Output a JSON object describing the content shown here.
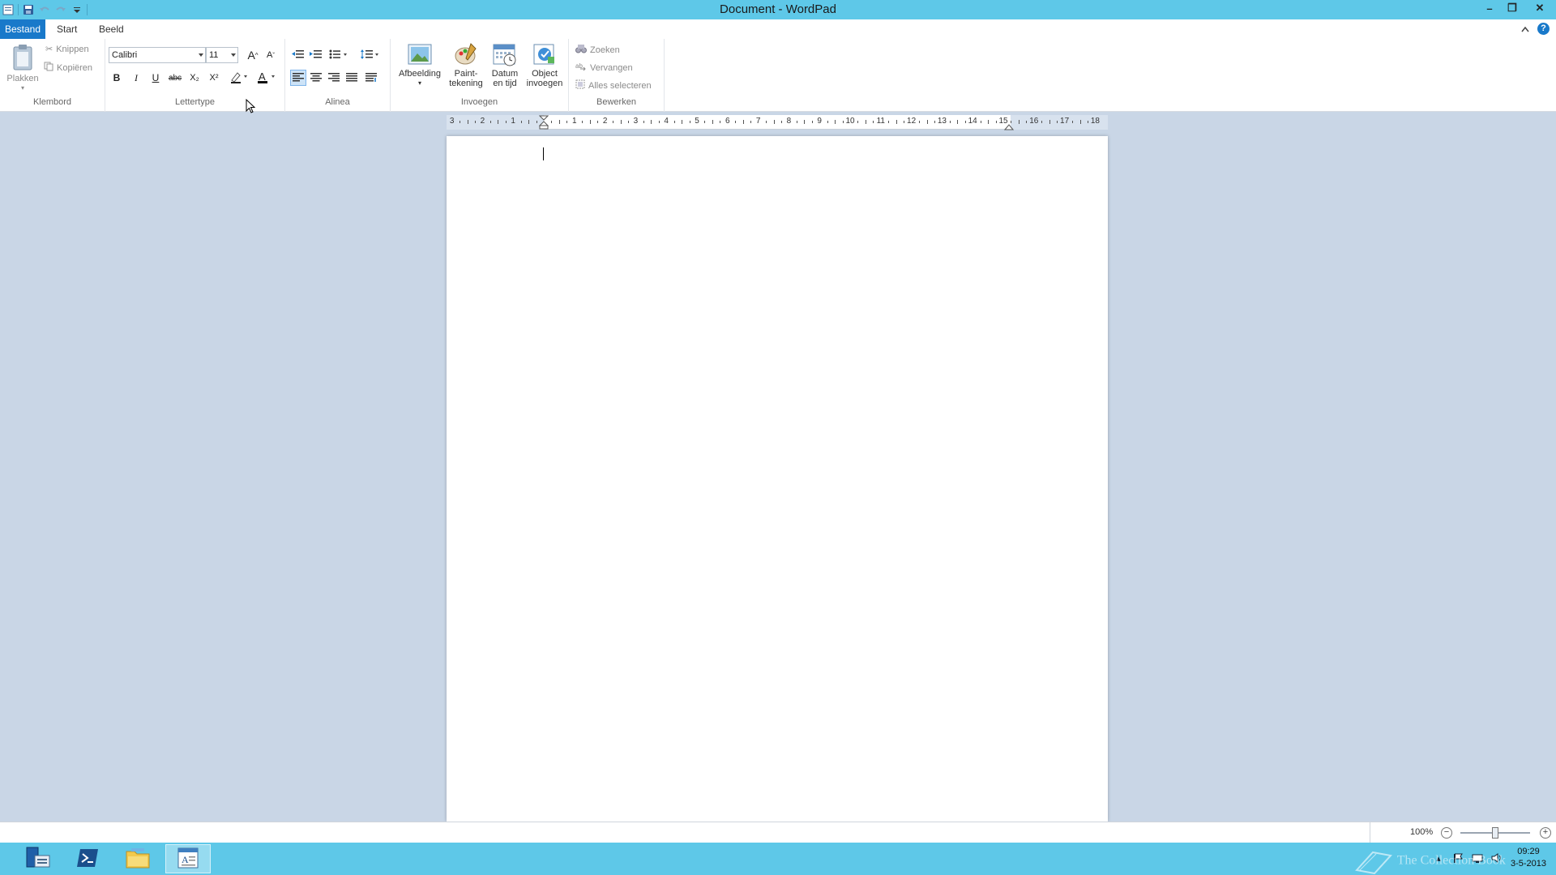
{
  "window": {
    "title": "Document - WordPad",
    "minimize": "–",
    "restore": "❐",
    "close": "✕"
  },
  "tabs": {
    "file": "Bestand",
    "home": "Start",
    "view": "Beeld"
  },
  "ribbon": {
    "clipboard": {
      "label": "Klembord",
      "paste": "Plakken",
      "cut": "Knippen",
      "copy": "Kopiëren"
    },
    "font": {
      "label": "Lettertype",
      "family": "Calibri",
      "size": "11",
      "bold": "B",
      "italic": "I",
      "underline": "U",
      "strike": "abc",
      "subscript": "X₂",
      "superscript": "X²",
      "grow": "A",
      "shrink": "A"
    },
    "paragraph": {
      "label": "Alinea"
    },
    "insert": {
      "label": "Invoegen",
      "picture": "Afbeelding",
      "paint_line1": "Paint-",
      "paint_line2": "tekening",
      "datetime_line1": "Datum",
      "datetime_line2": "en tijd",
      "object_line1": "Object",
      "object_line2": "invoegen"
    },
    "editing": {
      "label": "Bewerken",
      "find": "Zoeken",
      "replace": "Vervangen",
      "select_all": "Alles selecteren"
    }
  },
  "ruler": {
    "labels": [
      "3",
      "2",
      "1",
      "1",
      "2",
      "3",
      "4",
      "5",
      "6",
      "7",
      "8",
      "9",
      "10",
      "11",
      "12",
      "13",
      "14",
      "15",
      "16",
      "17",
      "18"
    ]
  },
  "status": {
    "zoom": "100%",
    "zoom_minus": "−",
    "zoom_plus": "+",
    "zoom_level": 0.5
  },
  "taskbar": {
    "time": "09:29",
    "date": "3-5-2013",
    "watermark": "The Collection Book"
  },
  "colors": {
    "titlebar": "#5ec8e8",
    "file_tab": "#1979ca",
    "workspace": "#c9d6e6"
  }
}
